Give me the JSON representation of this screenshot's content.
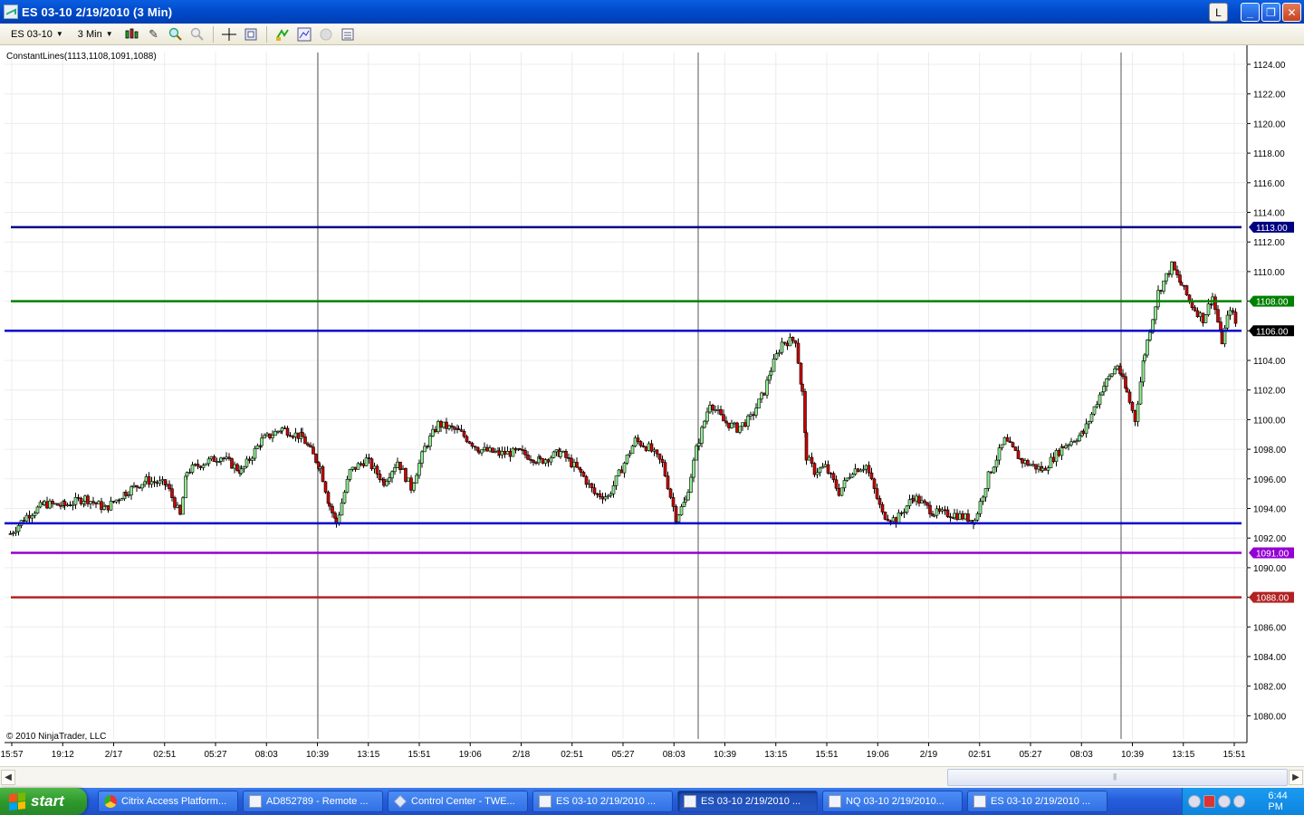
{
  "window": {
    "title": "ES 03-10  2/19/2010 (3 Min)",
    "btn_l": "L",
    "btn_min": "_",
    "btn_restore": "❐",
    "btn_close": "✕"
  },
  "toolbar": {
    "instrument": "ES 03-10",
    "interval": "3 Min"
  },
  "chart": {
    "indicator_label": "ConstantLines(1113,1108,1091,1088)",
    "copyright": "© 2010 NinjaTrader, LLC",
    "colors": {
      "line_1113": "#000080",
      "line_1108": "#008000",
      "line_1106": "#0000cc",
      "line_1093": "#0000cc",
      "line_1091": "#9400d3",
      "line_1088": "#b22222",
      "up_candle": "#90ee90",
      "down_candle": "#cc0000"
    }
  },
  "chart_data": {
    "type": "candlestick",
    "instrument": "ES 03-10",
    "interval": "3 Min",
    "ylim": [
      1078.5,
      1125
    ],
    "y_ticks": [
      "1124.00",
      "1122.00",
      "1120.00",
      "1118.00",
      "1116.00",
      "1114.00",
      "1112.00",
      "1110.00",
      "1108.00",
      "1106.00",
      "1104.00",
      "1102.00",
      "1100.00",
      "1098.00",
      "1096.00",
      "1094.00",
      "1092.00",
      "1090.00",
      "1088.00",
      "1086.00",
      "1084.00",
      "1082.00",
      "1080.00"
    ],
    "x_ticks": [
      "15:57",
      "19:12",
      "2/17",
      "02:51",
      "05:27",
      "08:03",
      "10:39",
      "13:15",
      "15:51",
      "19:06",
      "2/18",
      "02:51",
      "05:27",
      "08:03",
      "10:39",
      "13:15",
      "15:51",
      "19:06",
      "2/19",
      "02:51",
      "05:27",
      "08:03",
      "10:39",
      "13:15",
      "15:51"
    ],
    "horizontal_lines": [
      {
        "value": 1113,
        "label": "1113.00",
        "color": "#000080"
      },
      {
        "value": 1108,
        "label": "1108.00",
        "color": "#008000"
      },
      {
        "value": 1106,
        "label": "1106.00",
        "color": "#0000cc"
      },
      {
        "value": 1093,
        "label": "",
        "color": "#0000cc"
      },
      {
        "value": 1091,
        "label": "1091.00",
        "color": "#9400d3"
      },
      {
        "value": 1088,
        "label": "1088.00",
        "color": "#b22222"
      }
    ],
    "session_dividers": [
      "09:30 2/17",
      "09:30 2/18",
      "09:30 2/19"
    ],
    "close_path": [
      [
        0,
        1092.3
      ],
      [
        12,
        1093.5
      ],
      [
        25,
        1094.3
      ],
      [
        40,
        1094.2
      ],
      [
        55,
        1094.7
      ],
      [
        70,
        1094.0
      ],
      [
        85,
        1095.1
      ],
      [
        100,
        1095.9
      ],
      [
        115,
        1095.6
      ],
      [
        125,
        1093.5
      ],
      [
        130,
        1096.5
      ],
      [
        140,
        1097.0
      ],
      [
        155,
        1097.5
      ],
      [
        170,
        1096.5
      ],
      [
        185,
        1098.6
      ],
      [
        200,
        1099.4
      ],
      [
        215,
        1098.8
      ],
      [
        228,
        1096.8
      ],
      [
        235,
        1094.2
      ],
      [
        240,
        1093.0
      ],
      [
        250,
        1096.5
      ],
      [
        262,
        1097.3
      ],
      [
        275,
        1095.8
      ],
      [
        285,
        1097.2
      ],
      [
        295,
        1095.4
      ],
      [
        305,
        1098.1
      ],
      [
        315,
        1099.7
      ],
      [
        330,
        1099.2
      ],
      [
        345,
        1098.0
      ],
      [
        360,
        1097.7
      ],
      [
        375,
        1097.8
      ],
      [
        390,
        1097.2
      ],
      [
        405,
        1097.8
      ],
      [
        420,
        1096.4
      ],
      [
        430,
        1095.0
      ],
      [
        440,
        1094.8
      ],
      [
        450,
        1096.7
      ],
      [
        460,
        1098.6
      ],
      [
        470,
        1098.1
      ],
      [
        480,
        1097.0
      ],
      [
        490,
        1093.4
      ],
      [
        497,
        1094.5
      ],
      [
        505,
        1098.0
      ],
      [
        515,
        1101.2
      ],
      [
        525,
        1099.9
      ],
      [
        535,
        1099.4
      ],
      [
        545,
        1100.1
      ],
      [
        555,
        1101.9
      ],
      [
        560,
        1103.4
      ],
      [
        568,
        1105.2
      ],
      [
        578,
        1105.4
      ],
      [
        583,
        1101.8
      ],
      [
        586,
        1097.5
      ],
      [
        592,
        1096.5
      ],
      [
        600,
        1096.8
      ],
      [
        610,
        1095.1
      ],
      [
        620,
        1096.6
      ],
      [
        630,
        1096.9
      ],
      [
        642,
        1093.6
      ],
      [
        652,
        1093.2
      ],
      [
        665,
        1094.8
      ],
      [
        680,
        1093.7
      ],
      [
        695,
        1093.6
      ],
      [
        710,
        1093.2
      ],
      [
        720,
        1096.2
      ],
      [
        732,
        1098.6
      ],
      [
        745,
        1097.2
      ],
      [
        760,
        1096.6
      ],
      [
        775,
        1098.2
      ],
      [
        790,
        1099.1
      ],
      [
        805,
        1102.3
      ],
      [
        815,
        1103.7
      ],
      [
        822,
        1101.8
      ],
      [
        828,
        1100.0
      ],
      [
        835,
        1104.5
      ],
      [
        845,
        1108.6
      ],
      [
        855,
        1110.4
      ],
      [
        862,
        1109.1
      ],
      [
        870,
        1107.7
      ],
      [
        878,
        1106.8
      ],
      [
        885,
        1108.3
      ],
      [
        892,
        1105.3
      ],
      [
        898,
        1107.6
      ],
      [
        903,
        1106.2
      ]
    ]
  },
  "scrollbar": {
    "left_arrow": "◀",
    "right_arrow": "▶"
  },
  "taskbar": {
    "start_label": "start",
    "items": [
      {
        "label": "Citrix Access Platform...",
        "icon": "chrome-icon"
      },
      {
        "label": "AD852789 - Remote ...",
        "icon": "remote-desktop-icon"
      },
      {
        "label": "Control Center - TWE...",
        "icon": "ninjatrader-icon"
      },
      {
        "label": "ES 03-10  2/19/2010 ...",
        "icon": "chart-icon"
      },
      {
        "label": "ES 03-10  2/19/2010 ...",
        "icon": "chart-icon"
      },
      {
        "label": "NQ 03-10  2/19/2010...",
        "icon": "chart-icon"
      },
      {
        "label": "ES 03-10  2/19/2010 ...",
        "icon": "chart-icon"
      }
    ],
    "clock": "6:44 PM"
  }
}
